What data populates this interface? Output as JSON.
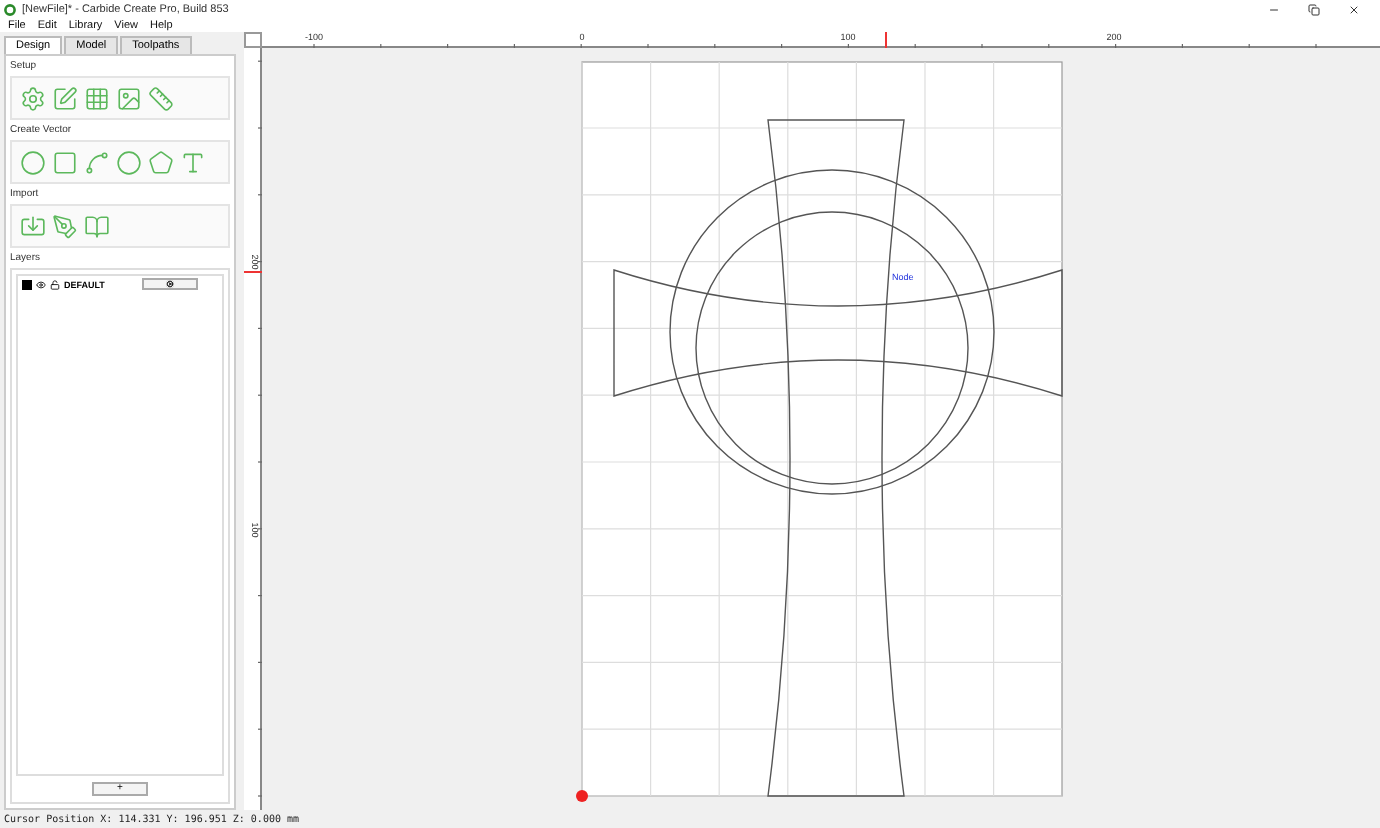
{
  "window": {
    "title": "[NewFile]* - Carbide Create Pro, Build 853"
  },
  "menu": [
    "File",
    "Edit",
    "Library",
    "View",
    "Help"
  ],
  "tabs": [
    {
      "label": "Design",
      "selected": true
    },
    {
      "label": "Model",
      "selected": false
    },
    {
      "label": "Toolpaths",
      "selected": false
    }
  ],
  "sections": [
    {
      "title": "Setup"
    },
    {
      "title": "Create Vector"
    },
    {
      "title": "Import"
    }
  ],
  "layers": {
    "title": "Layers",
    "items": [
      {
        "name": "DEFAULT",
        "color": "#000000"
      }
    ],
    "add_button": "+"
  },
  "rulers": {
    "horizontal": [
      "-100",
      "0",
      "100",
      "200"
    ],
    "vertical": [
      "200",
      "100"
    ]
  },
  "canvas": {
    "node_label": "Node"
  },
  "status_bar": "Cursor Position X: 114.331 Y: 196.951 Z: 0.000 mm"
}
